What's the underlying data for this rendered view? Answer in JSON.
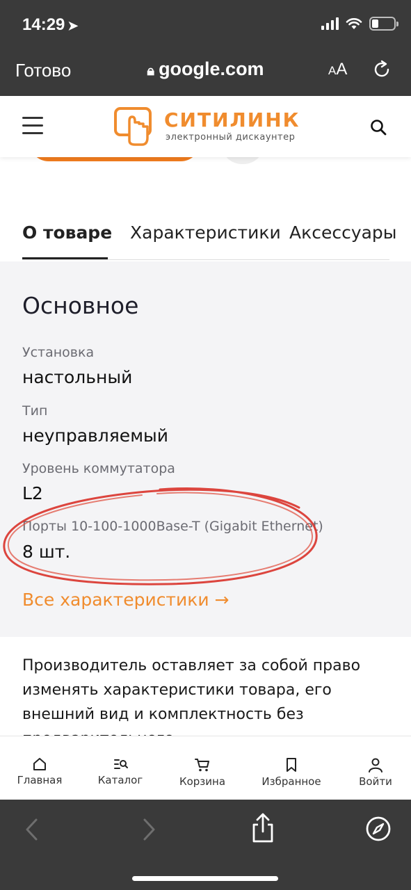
{
  "status_bar": {
    "time": "14:29",
    "location_icon": "location-arrow-icon",
    "battery_level": 0.3
  },
  "browser": {
    "done_label": "Готово",
    "url": "google.com",
    "text_size_label_small": "A",
    "text_size_label_large": "A"
  },
  "site": {
    "logo_name": "СИТИЛИНК",
    "logo_tagline": "электронный дискаунтер"
  },
  "tabs": [
    {
      "label": "О товаре",
      "active": true
    },
    {
      "label": "Характеристики",
      "active": false
    },
    {
      "label": "Аксессуары",
      "active": false
    }
  ],
  "specs": {
    "title": "Основное",
    "items": [
      {
        "label": "Установка",
        "value": "настольный"
      },
      {
        "label": "Тип",
        "value": "неуправляемый"
      },
      {
        "label": "Уровень коммутатора",
        "value": "L2"
      },
      {
        "label": "Порты 10-100-1000Base-T (Gigabit Ethernet)",
        "value": "8 шт."
      }
    ],
    "all_link": "Все характеристики →",
    "accent_color": "#f08c2e",
    "annotation_color": "#d9322a"
  },
  "disclaimer": "Производитель оставляет за собой право изменять характеристики товара, его внешний вид и комплектность без предварительного",
  "bottom_nav": [
    {
      "label": "Главная",
      "icon": "home-icon"
    },
    {
      "label": "Каталог",
      "icon": "catalog-icon"
    },
    {
      "label": "Корзина",
      "icon": "cart-icon"
    },
    {
      "label": "Избранное",
      "icon": "bookmark-icon"
    },
    {
      "label": "Войти",
      "icon": "user-icon"
    }
  ]
}
